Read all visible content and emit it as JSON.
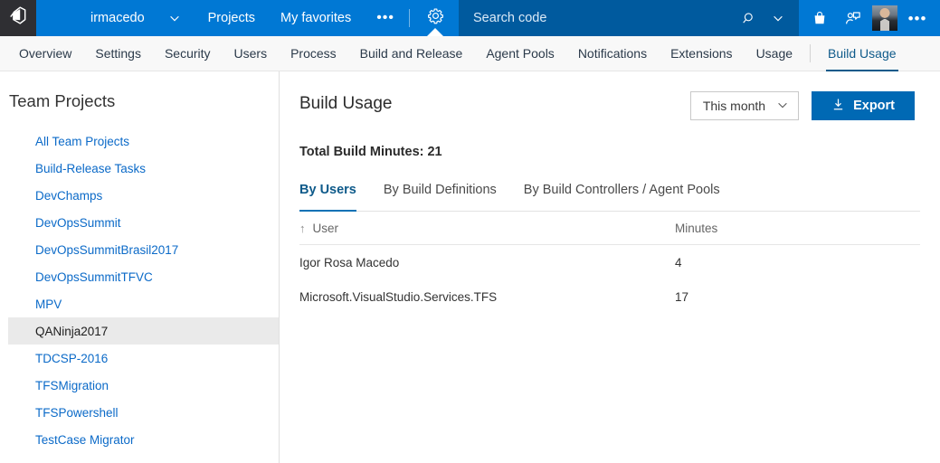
{
  "topbar": {
    "logo_icon": "vsts-logo-icon",
    "account_name": "irmacedo",
    "account_chevron_icon": "chevron-down-icon",
    "links": [
      {
        "label": "Projects",
        "name": "projects"
      },
      {
        "label": "My favorites",
        "name": "my-favorites"
      }
    ],
    "more_label": "•••",
    "settings_icon": "gear-icon",
    "search_placeholder": "Search code",
    "search_icon": "search-icon",
    "search_chevron_icon": "chevron-down-icon",
    "marketplace_icon": "shopping-bag-icon",
    "feedback_icon": "user-feedback-icon",
    "avatar_icon": "user-avatar",
    "overflow_icon": "ellipsis-icon",
    "accent_color": "#0078d4",
    "search_bg_color": "#005a9e",
    "logo_bg_color": "#2f2f33"
  },
  "hubbar": {
    "items": [
      {
        "label": "Overview",
        "name": "overview",
        "active": false
      },
      {
        "label": "Settings",
        "name": "settings",
        "active": false
      },
      {
        "label": "Security",
        "name": "security",
        "active": false
      },
      {
        "label": "Users",
        "name": "users",
        "active": false
      },
      {
        "label": "Process",
        "name": "process",
        "active": false
      },
      {
        "label": "Build and Release",
        "name": "build-and-release",
        "active": false
      },
      {
        "label": "Agent Pools",
        "name": "agent-pools",
        "active": false
      },
      {
        "label": "Notifications",
        "name": "notifications",
        "active": false
      },
      {
        "label": "Extensions",
        "name": "extensions",
        "active": false
      },
      {
        "label": "Usage",
        "name": "usage",
        "active": false
      },
      {
        "label": "Build Usage",
        "name": "build-usage",
        "active": true
      }
    ],
    "active_color": "#0e5a8a"
  },
  "sidebar": {
    "title": "Team Projects",
    "items": [
      {
        "label": "All Team Projects",
        "selected": false
      },
      {
        "label": "Build-Release Tasks",
        "selected": false
      },
      {
        "label": "DevChamps",
        "selected": false
      },
      {
        "label": "DevOpsSummit",
        "selected": false
      },
      {
        "label": "DevOpsSummitBrasil2017",
        "selected": false
      },
      {
        "label": "DevOpsSummitTFVC",
        "selected": false
      },
      {
        "label": "MPV",
        "selected": false
      },
      {
        "label": "QANinja2017",
        "selected": true
      },
      {
        "label": "TDCSP-2016",
        "selected": false
      },
      {
        "label": "TFSMigration",
        "selected": false
      },
      {
        "label": "TFSPowershell",
        "selected": false
      },
      {
        "label": "TestCase Migrator",
        "selected": false
      }
    ],
    "link_color": "#0b6ac8",
    "selected_bg": "#eaeaea"
  },
  "main": {
    "page_title": "Build Usage",
    "period_value": "This month",
    "period_chevron_icon": "chevron-down-icon",
    "export_label": "Export",
    "export_icon": "download-icon",
    "export_color": "#0069b4",
    "total_label": "Total Build Minutes: 21",
    "tabs": [
      {
        "label": "By Users",
        "name": "by-users",
        "active": true
      },
      {
        "label": "By Build Definitions",
        "name": "by-build-definitions",
        "active": false
      },
      {
        "label": "By Build Controllers / Agent Pools",
        "name": "by-build-controllers-agent-pools",
        "active": false
      }
    ],
    "table": {
      "sort_icon": "sort-ascending-arrow",
      "columns": [
        "User",
        "Minutes"
      ],
      "rows": [
        {
          "user": "Igor Rosa Macedo",
          "minutes": "4"
        },
        {
          "user": "Microsoft.VisualStudio.Services.TFS",
          "minutes": "17"
        }
      ]
    }
  }
}
